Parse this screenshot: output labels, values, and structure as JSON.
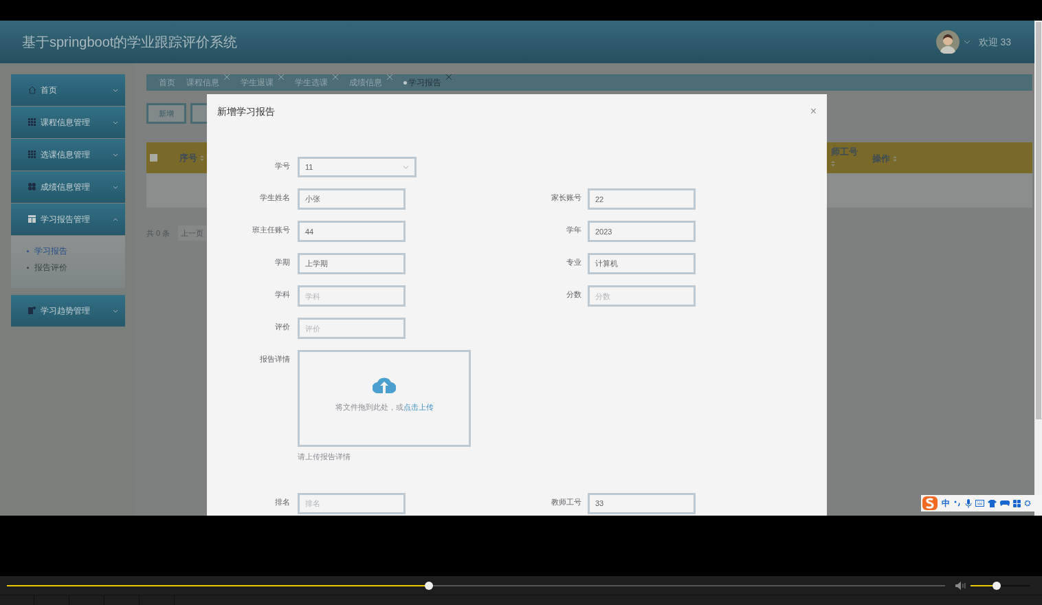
{
  "header": {
    "title": "基于springboot的学业跟踪评价系统",
    "welcome": "欢迎 33"
  },
  "sidebar": {
    "items": [
      {
        "label": "首页",
        "expanded": false
      },
      {
        "label": "课程信息管理",
        "expanded": false
      },
      {
        "label": "选课信息管理",
        "expanded": false
      },
      {
        "label": "成绩信息管理",
        "expanded": false
      },
      {
        "label": "学习报告管理",
        "expanded": true,
        "children": [
          {
            "label": "学习报告",
            "selected": true
          },
          {
            "label": "报告评价",
            "selected": false
          }
        ]
      },
      {
        "label": "学习趋势管理",
        "expanded": false
      }
    ]
  },
  "tabs": [
    {
      "label": "首页",
      "closable": false,
      "selected": false
    },
    {
      "label": "课程信息",
      "closable": true,
      "selected": false
    },
    {
      "label": "学生退课",
      "closable": true,
      "selected": false
    },
    {
      "label": "学生选课",
      "closable": true,
      "selected": false
    },
    {
      "label": "成绩信息",
      "closable": true,
      "selected": false
    },
    {
      "label": "学习报告",
      "closable": true,
      "selected": true
    }
  ],
  "toolbar": {
    "buttons": [
      "新增"
    ]
  },
  "table": {
    "select_all": {
      "checked": false
    },
    "columns": [
      "序号",
      "师工号",
      "操作"
    ]
  },
  "pagination": {
    "total": "共 0 条",
    "prev": "上一页"
  },
  "dialog": {
    "title": "新增学习报告",
    "close": "×",
    "rows": [
      {
        "fields": [
          {
            "label": "学号",
            "kind": "select",
            "value": "11"
          }
        ]
      },
      {
        "fields": [
          {
            "label": "学生姓名",
            "kind": "text",
            "value": "小张"
          },
          {
            "label": "家长账号",
            "kind": "text",
            "value": "22"
          }
        ]
      },
      {
        "fields": [
          {
            "label": "班主任账号",
            "kind": "text",
            "value": "44"
          },
          {
            "label": "学年",
            "kind": "text",
            "value": "2023"
          }
        ]
      },
      {
        "fields": [
          {
            "label": "学期",
            "kind": "text",
            "value": "上学期"
          },
          {
            "label": "专业",
            "kind": "text",
            "value": "计算机"
          }
        ]
      },
      {
        "fields": [
          {
            "label": "学科",
            "kind": "text",
            "placeholder": "学科"
          },
          {
            "label": "分数",
            "kind": "text",
            "placeholder": "分数"
          }
        ]
      },
      {
        "fields": [
          {
            "label": "评价",
            "kind": "text",
            "placeholder": "评价"
          }
        ]
      },
      {
        "fields": [
          {
            "label": "报告详情",
            "kind": "upload",
            "prompt": "将文件拖到此处，或",
            "link": "点击上传",
            "hint": "请上传报告详情"
          }
        ]
      },
      {
        "fields": [
          {
            "label": "排名",
            "kind": "text",
            "placeholder": "排名"
          },
          {
            "label": "教师工号",
            "kind": "text",
            "value": "33"
          }
        ]
      }
    ]
  },
  "ime_toolbar": {
    "language": "中"
  },
  "player": {
    "progress": {
      "level": 0.45
    },
    "volume": {
      "level": 0.44
    }
  }
}
